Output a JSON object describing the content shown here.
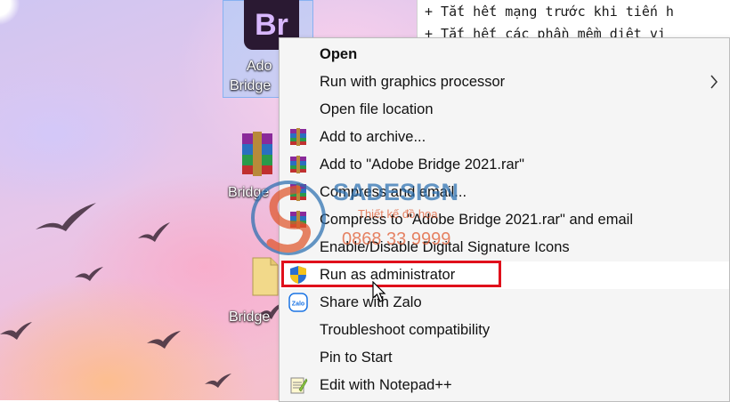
{
  "console": {
    "line1": "+ Tắt hết mạng trước khi tiến h",
    "line2": "+ Tắt hết các phần mềm diệt vi"
  },
  "desktop_icons": [
    {
      "label_line1": "Ado",
      "label_line2": "Bridge",
      "icon": "adobe-bridge-icon",
      "logo_text": "Br"
    },
    {
      "label": "Bridge",
      "icon": "winrar-archive-icon"
    },
    {
      "label": "Bridge",
      "icon": "file-icon"
    }
  ],
  "context_menu": {
    "items": [
      {
        "label": "Open",
        "bold": true,
        "icon": ""
      },
      {
        "label": "Run with graphics processor",
        "submenu": true,
        "icon": ""
      },
      {
        "label": "Open file location",
        "icon": ""
      },
      {
        "label": "Add to archive...",
        "icon": "winrar-icon"
      },
      {
        "label": "Add to \"Adobe Bridge 2021.rar\"",
        "icon": "winrar-icon"
      },
      {
        "label": "Compress and email...",
        "icon": "winrar-icon"
      },
      {
        "label": "Compress to \"Adobe Bridge 2021.rar\" and email",
        "icon": "winrar-icon"
      },
      {
        "label": "Enable/Disable Digital Signature Icons",
        "icon": ""
      },
      {
        "label": "Run as administrator",
        "icon": "uac-shield-icon",
        "highlighted": true
      },
      {
        "label": "Share with Zalo",
        "icon": "zalo-icon"
      },
      {
        "label": "Troubleshoot compatibility",
        "icon": ""
      },
      {
        "label": "Pin to Start",
        "icon": ""
      },
      {
        "label": "Edit with Notepad++",
        "icon": "notepad-plus-plus-icon"
      }
    ]
  },
  "watermark": {
    "brand": "SADESIGN",
    "subtitle": "Thiết kế đồ họa",
    "phone": "0868 33 9999"
  },
  "colors": {
    "highlight_border": "#e0101b",
    "menu_bg": "#f5f5f5",
    "watermark_blue": "#2a6fb0"
  }
}
